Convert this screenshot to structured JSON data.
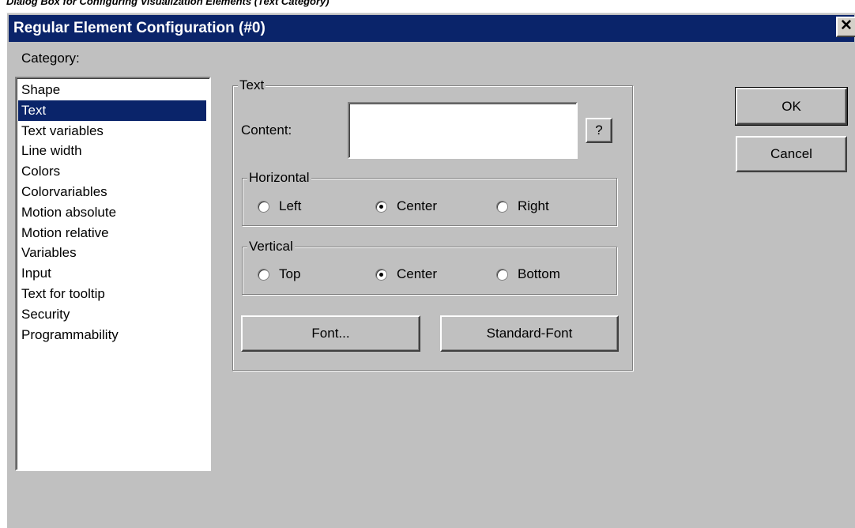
{
  "caption": "Dialog Box for Configuring Visualization Elements (Text Category)",
  "window": {
    "title": "Regular Element Configuration (#0)",
    "close_glyph": "✕"
  },
  "category": {
    "label": "Category:",
    "items": [
      {
        "label": "Shape",
        "selected": false
      },
      {
        "label": "Text",
        "selected": true
      },
      {
        "label": "Text variables",
        "selected": false
      },
      {
        "label": "Line width",
        "selected": false
      },
      {
        "label": "Colors",
        "selected": false
      },
      {
        "label": "Colorvariables",
        "selected": false
      },
      {
        "label": "Motion absolute",
        "selected": false
      },
      {
        "label": "Motion relative",
        "selected": false
      },
      {
        "label": "Variables",
        "selected": false
      },
      {
        "label": "Input",
        "selected": false
      },
      {
        "label": "Text for tooltip",
        "selected": false
      },
      {
        "label": "Security",
        "selected": false
      },
      {
        "label": "Programmability",
        "selected": false
      }
    ]
  },
  "text_group": {
    "title": "Text",
    "content_label": "Content:",
    "content_value": "",
    "help_button": "?",
    "horizontal": {
      "title": "Horizontal",
      "options": [
        "Left",
        "Center",
        "Right"
      ],
      "selected": "Center"
    },
    "vertical": {
      "title": "Vertical",
      "options": [
        "Top",
        "Center",
        "Bottom"
      ],
      "selected": "Center"
    },
    "font_button": "Font...",
    "standard_font_button": "Standard-Font"
  },
  "buttons": {
    "ok": "OK",
    "cancel": "Cancel"
  }
}
